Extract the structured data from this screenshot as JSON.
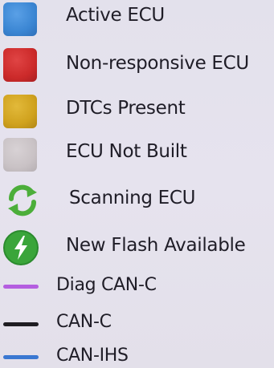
{
  "legend": {
    "items": [
      {
        "label": "Active ECU",
        "icon": "blue-square-icon",
        "color": "#3b86d3"
      },
      {
        "label": "Non-responsive ECU",
        "icon": "red-square-icon",
        "color": "#cc2a2a"
      },
      {
        "label": "DTCs Present",
        "icon": "yellow-square-icon",
        "color": "#d0a21e"
      },
      {
        "label": "ECU Not Built",
        "icon": "gray-square-icon",
        "color": "#c9c2c5"
      },
      {
        "label": "Scanning ECU",
        "icon": "refresh-arrows-icon",
        "color": "#4cae3a"
      },
      {
        "label": "New Flash Available",
        "icon": "lightning-circle-icon",
        "color": "#3aa53a"
      }
    ],
    "lines": [
      {
        "label": "Diag CAN-C",
        "icon": "purple-line-icon",
        "color": "#b45ee0"
      },
      {
        "label": "CAN-C",
        "icon": "black-line-icon",
        "color": "#1f1d22"
      },
      {
        "label": "CAN-IHS",
        "icon": "blue-line-icon",
        "color": "#3a78d2"
      }
    ]
  }
}
